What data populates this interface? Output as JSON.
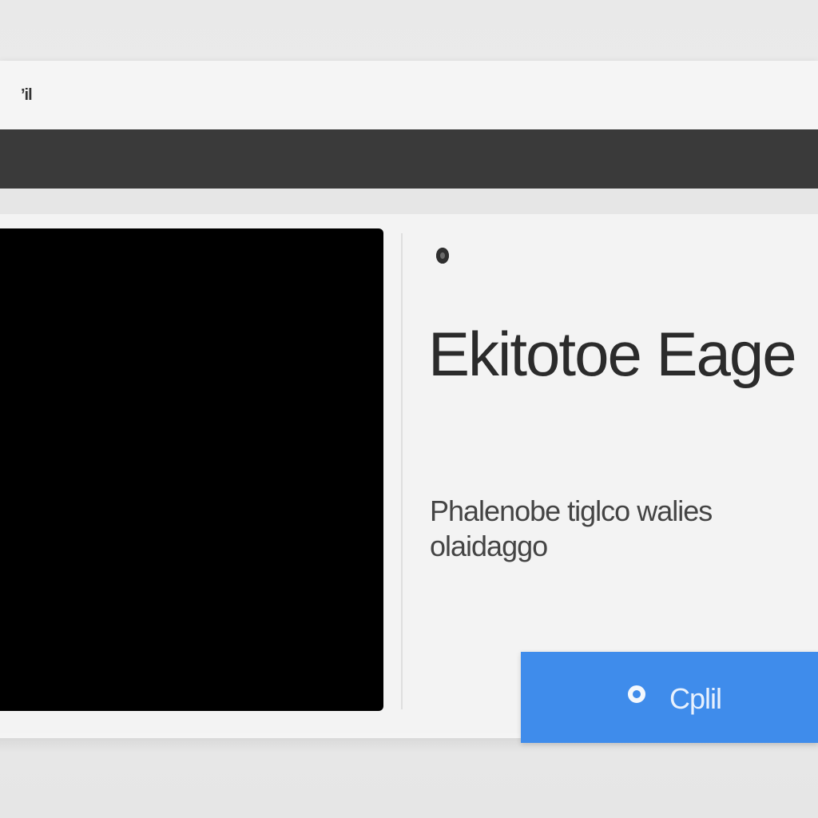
{
  "window": {
    "title": "’il",
    "heading": "Ekitotoe Eage",
    "description": "Phalenobe tiglco walies olaidaggo",
    "primary_button": {
      "label": "Cplil",
      "icon": "circle-icon"
    }
  },
  "colors": {
    "accent": "#3f8ceb",
    "dark_bar": "#3a3a3a",
    "video_bg": "#000000"
  }
}
